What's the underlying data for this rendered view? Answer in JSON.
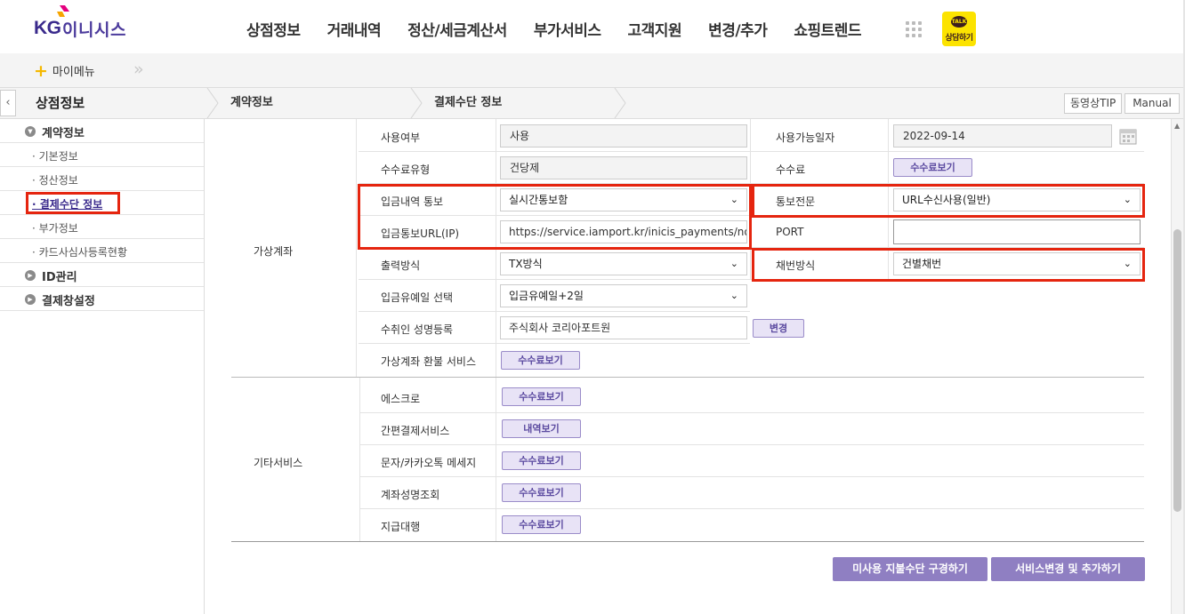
{
  "brand": {
    "logo_kg": "KG",
    "logo_name": "이니시스"
  },
  "gnb": {
    "items": [
      "상점정보",
      "거래내역",
      "정산/세금계산서",
      "부가서비스",
      "고객지원",
      "변경/추가",
      "쇼핑트렌드"
    ],
    "talk_badge": "TALK",
    "talk_label": "상담하기"
  },
  "mymenu": {
    "label": "마이메뉴"
  },
  "breadcrumb": {
    "items": [
      "상점정보",
      "계약정보",
      "결제수단 정보"
    ],
    "tip_label": "동영상TIP",
    "manual_label": "Manual"
  },
  "sidebar": {
    "groups": [
      {
        "label": "계약정보",
        "expanded": true
      },
      {
        "label": "ID관리",
        "expanded": false
      },
      {
        "label": "결제창설정",
        "expanded": false
      }
    ],
    "sub_items": [
      "· 기본정보",
      "· 정산정보",
      "· 결제수단 정보",
      "· 부가정보",
      "· 카드사심사등록현황"
    ],
    "active_index": 2
  },
  "virtual_account": {
    "group_label": "가상계좌",
    "rows": {
      "usage_label": "사용여부",
      "usage_value": "사용",
      "available_date_label": "사용가능일자",
      "available_date_value": "2022-09-14",
      "fee_type_label": "수수료유형",
      "fee_type_value": "건당제",
      "fee_label": "수수료",
      "fee_button": "수수료보기",
      "deposit_notify_label": "입금내역 통보",
      "deposit_notify_value": "실시간통보함",
      "notify_format_label": "통보전문",
      "notify_format_value": "URL수신사용(일반)",
      "notify_url_label": "입금통보URL(IP)",
      "notify_url_value": "https://service.iamport.kr/inicis_payments/not",
      "port_label": "PORT",
      "port_value": "",
      "output_label": "출력방식",
      "output_value": "TX방식",
      "numbering_label": "채번방식",
      "numbering_value": "건별채번",
      "grace_label": "입금유예일 선택",
      "grace_value": "입금유예일+2일",
      "payee_label": "수취인 성명등록",
      "payee_value": "주식회사 코리아포트원",
      "payee_button": "변경",
      "refund_label": "가상계좌 환불 서비스",
      "refund_button": "수수료보기"
    }
  },
  "other_services": {
    "group_label": "기타서비스",
    "items": [
      {
        "label": "에스크로",
        "button": "수수료보기"
      },
      {
        "label": "간편결제서비스",
        "button": "내역보기"
      },
      {
        "label": "문자/카카오톡 메세지",
        "button": "수수료보기"
      },
      {
        "label": "계좌성명조회",
        "button": "수수료보기"
      },
      {
        "label": "지급대행",
        "button": "수수료보기"
      }
    ]
  },
  "actions": {
    "unused_button": "미사용 지불수단 구경하기",
    "change_button": "서비스변경 및 추가하기"
  },
  "colors": {
    "accent_purple": "#8f7fc2",
    "highlight_red": "#e5250f",
    "brand_navy": "#3a2a8c",
    "talk_yellow": "#fce300"
  }
}
